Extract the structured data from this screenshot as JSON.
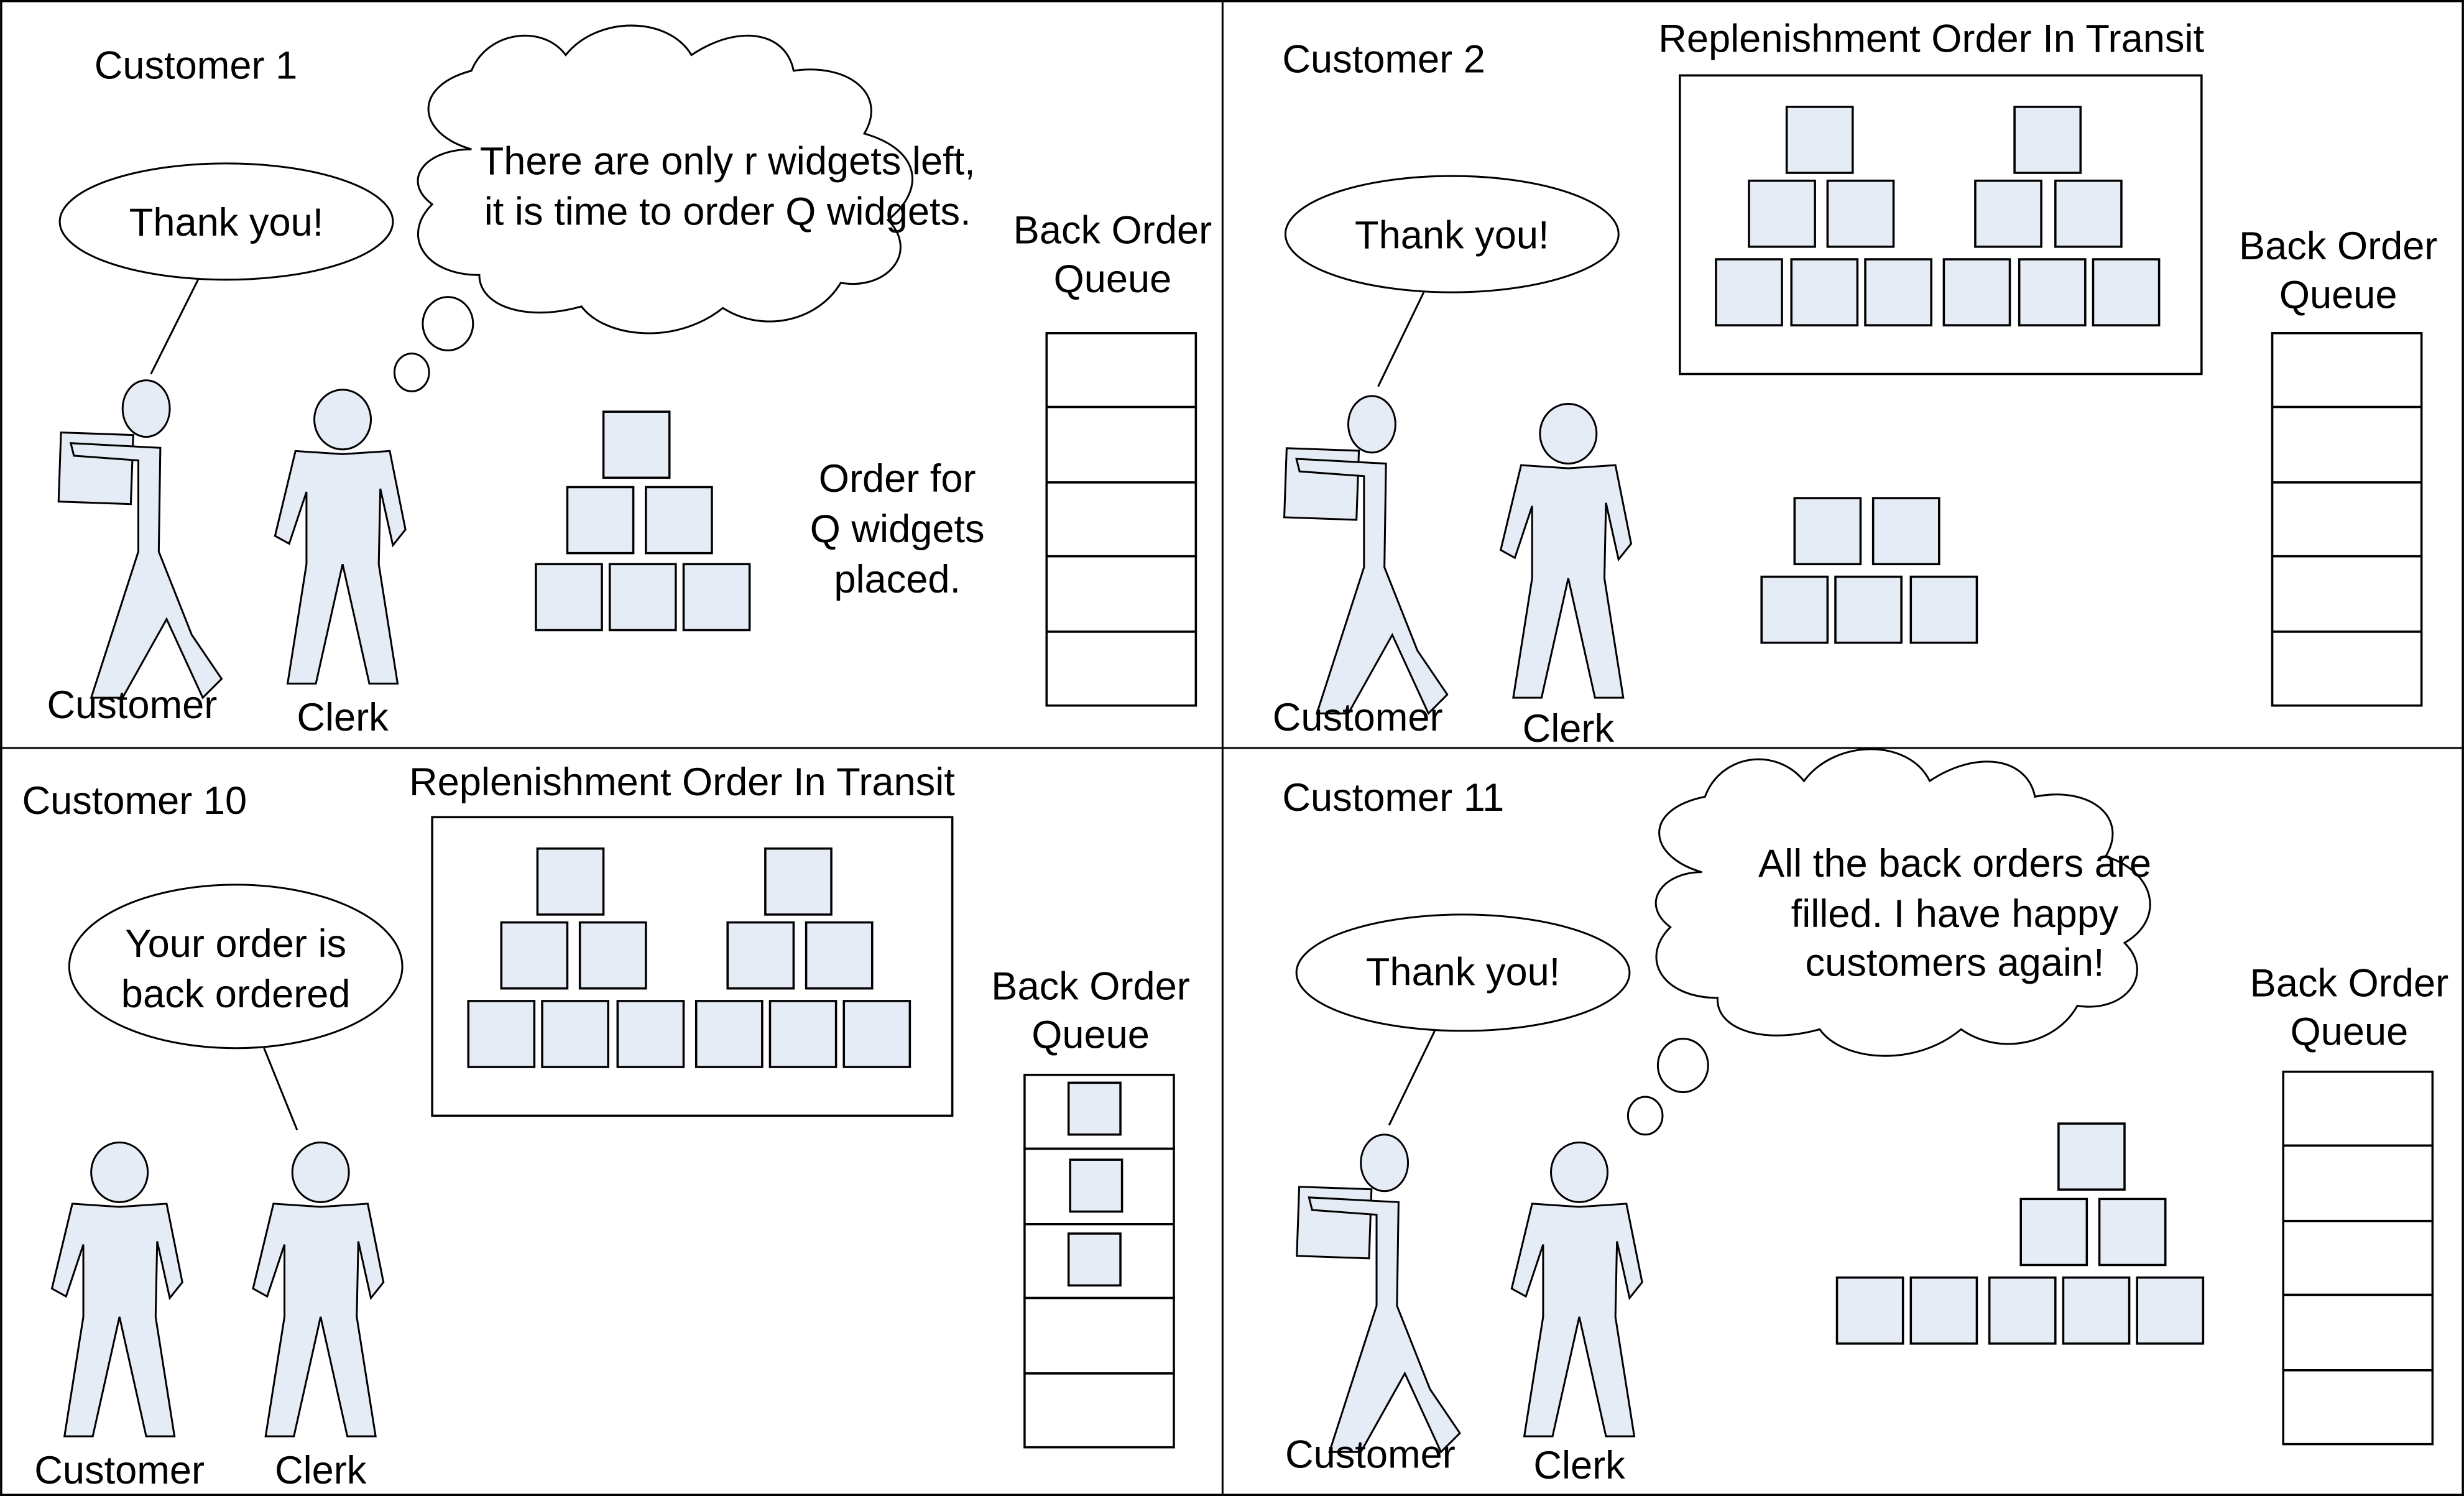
{
  "panels": [
    {
      "title": "Customer 1",
      "speech": "Thank you!",
      "thought_lines": [
        "There are only r widgets left,",
        "it is time to order Q widgets."
      ],
      "note_lines": [
        "Order for",
        "Q widgets",
        "placed."
      ],
      "customer_label": "Customer",
      "clerk_label": "Clerk",
      "queue_label_lines": [
        "Back Order",
        "Queue"
      ],
      "inventory_count": 6,
      "queue_slots": 5,
      "queue_filled": 0
    },
    {
      "title": "Customer 2",
      "speech": "Thank you!",
      "transit_label": "Replenishment Order In Transit",
      "transit_count": 12,
      "customer_label": "Customer",
      "clerk_label": "Clerk",
      "queue_label_lines": [
        "Back Order",
        "Queue"
      ],
      "inventory_count": 5,
      "queue_slots": 5,
      "queue_filled": 0
    },
    {
      "title": "Customer 10",
      "speech_lines": [
        "Your order is",
        "back ordered"
      ],
      "transit_label": "Replenishment Order In Transit",
      "transit_count": 12,
      "customer_label": "Customer",
      "clerk_label": "Clerk",
      "queue_label_lines": [
        "Back Order",
        "Queue"
      ],
      "inventory_count": 0,
      "queue_slots": 5,
      "queue_filled": 3
    },
    {
      "title": "Customer 11",
      "speech": "Thank you!",
      "thought_lines": [
        "All the back orders are",
        "filled.  I have happy",
        "customers again!"
      ],
      "customer_label": "Customer",
      "clerk_label": "Clerk",
      "queue_label_lines": [
        "Back Order",
        "Queue"
      ],
      "inventory_count": 8,
      "queue_slots": 5,
      "queue_filled": 0
    }
  ]
}
